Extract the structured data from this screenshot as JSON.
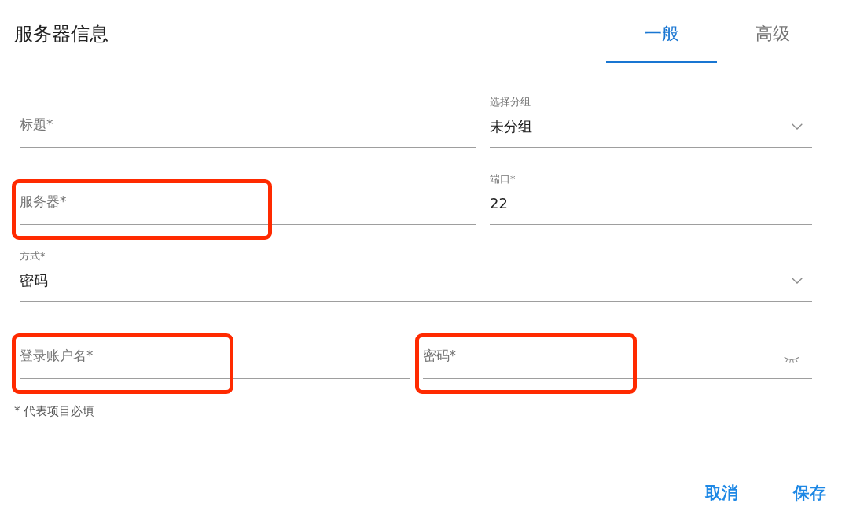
{
  "header": {
    "title": "服务器信息"
  },
  "tabs": [
    {
      "label": "一般",
      "selected": true
    },
    {
      "label": "高级",
      "selected": false
    }
  ],
  "form": {
    "rows": [
      {
        "kind": "main_side",
        "fields": [
          {
            "kind": "text",
            "placeholder": "标题*",
            "highlighted": false
          },
          {
            "kind": "select",
            "label": "选择分组",
            "value": "未分组",
            "highlighted": false
          }
        ]
      },
      {
        "kind": "main_side",
        "fields": [
          {
            "kind": "text",
            "placeholder": "服务器*",
            "highlighted": true
          },
          {
            "kind": "text",
            "label": "端口*",
            "value": "22",
            "highlighted": false
          }
        ]
      },
      {
        "kind": "single",
        "fields": [
          {
            "kind": "select",
            "label": "方式*",
            "value": "密码",
            "highlighted": false
          }
        ]
      },
      {
        "kind": "halves",
        "fields": [
          {
            "kind": "text",
            "placeholder": "登录账户名*",
            "highlighted": true
          },
          {
            "kind": "password",
            "placeholder": "密码*",
            "highlighted": true
          }
        ]
      }
    ]
  },
  "required_note": "* 代表项目必填",
  "buttons": [
    {
      "label": "取消"
    },
    {
      "label": "保存"
    }
  ]
}
